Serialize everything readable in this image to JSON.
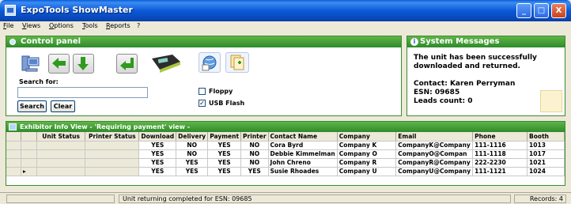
{
  "window": {
    "title": "ExpoTools ShowMaster",
    "controls": [
      "_",
      "□",
      "X"
    ]
  },
  "menu": [
    "File",
    "Views",
    "Options",
    "Tools",
    "Reports",
    "?"
  ],
  "control_panel": {
    "title": "Control panel",
    "search_label": "Search for:",
    "search_value": "",
    "search_button": "Search",
    "clear_button": "Clear",
    "floppy_label": "Floppy",
    "floppy_checked": false,
    "usb_label": "USB Flash",
    "usb_checked": true,
    "icons": [
      "computer-icon",
      "arrow-left-icon",
      "arrow-down-icon",
      "return-arrow-icon",
      "handheld-scanner-icon",
      "globe-icon",
      "copy-add-icon"
    ]
  },
  "system_messages": {
    "title": "System Messages",
    "message_line1": "The unit has been successfully",
    "message_line2": "downloaded and returned.",
    "contact": "Contact: Karen Perryman",
    "esn": "ESN: 09685",
    "leads": "Leads count: 0"
  },
  "exhibitor_view": {
    "title": "Exhibitor Info View - 'Requiring payment' view -",
    "columns": [
      "Unit Status",
      "Printer Status",
      "Download",
      "Delivery",
      "Payment",
      "Printer",
      "Contact Name",
      "Company",
      "Email",
      "Phone",
      "Booth"
    ],
    "rows": [
      [
        "",
        "",
        "YES",
        "NO",
        "YES",
        "NO",
        "Cora Byrd",
        "Company K",
        "CompanyK@Company",
        "111-1116",
        "1013"
      ],
      [
        "",
        "",
        "YES",
        "NO",
        "YES",
        "NO",
        "Debbie Kimmelman",
        "Company O",
        "CompanyO@Compan",
        "111-1118",
        "1017"
      ],
      [
        "",
        "",
        "YES",
        "YES",
        "YES",
        "NO",
        "John Chreno",
        "Company R",
        "CompanyR@Company",
        "222-2230",
        "1021"
      ],
      [
        "",
        "",
        "YES",
        "YES",
        "YES",
        "YES",
        "Susie Rhoades",
        "Company U",
        "CompanyU@Company",
        "111-1121",
        "1024"
      ]
    ]
  },
  "status_bar": {
    "message": "Unit returning completed for ESN: 09685",
    "records": "Records: 4"
  }
}
